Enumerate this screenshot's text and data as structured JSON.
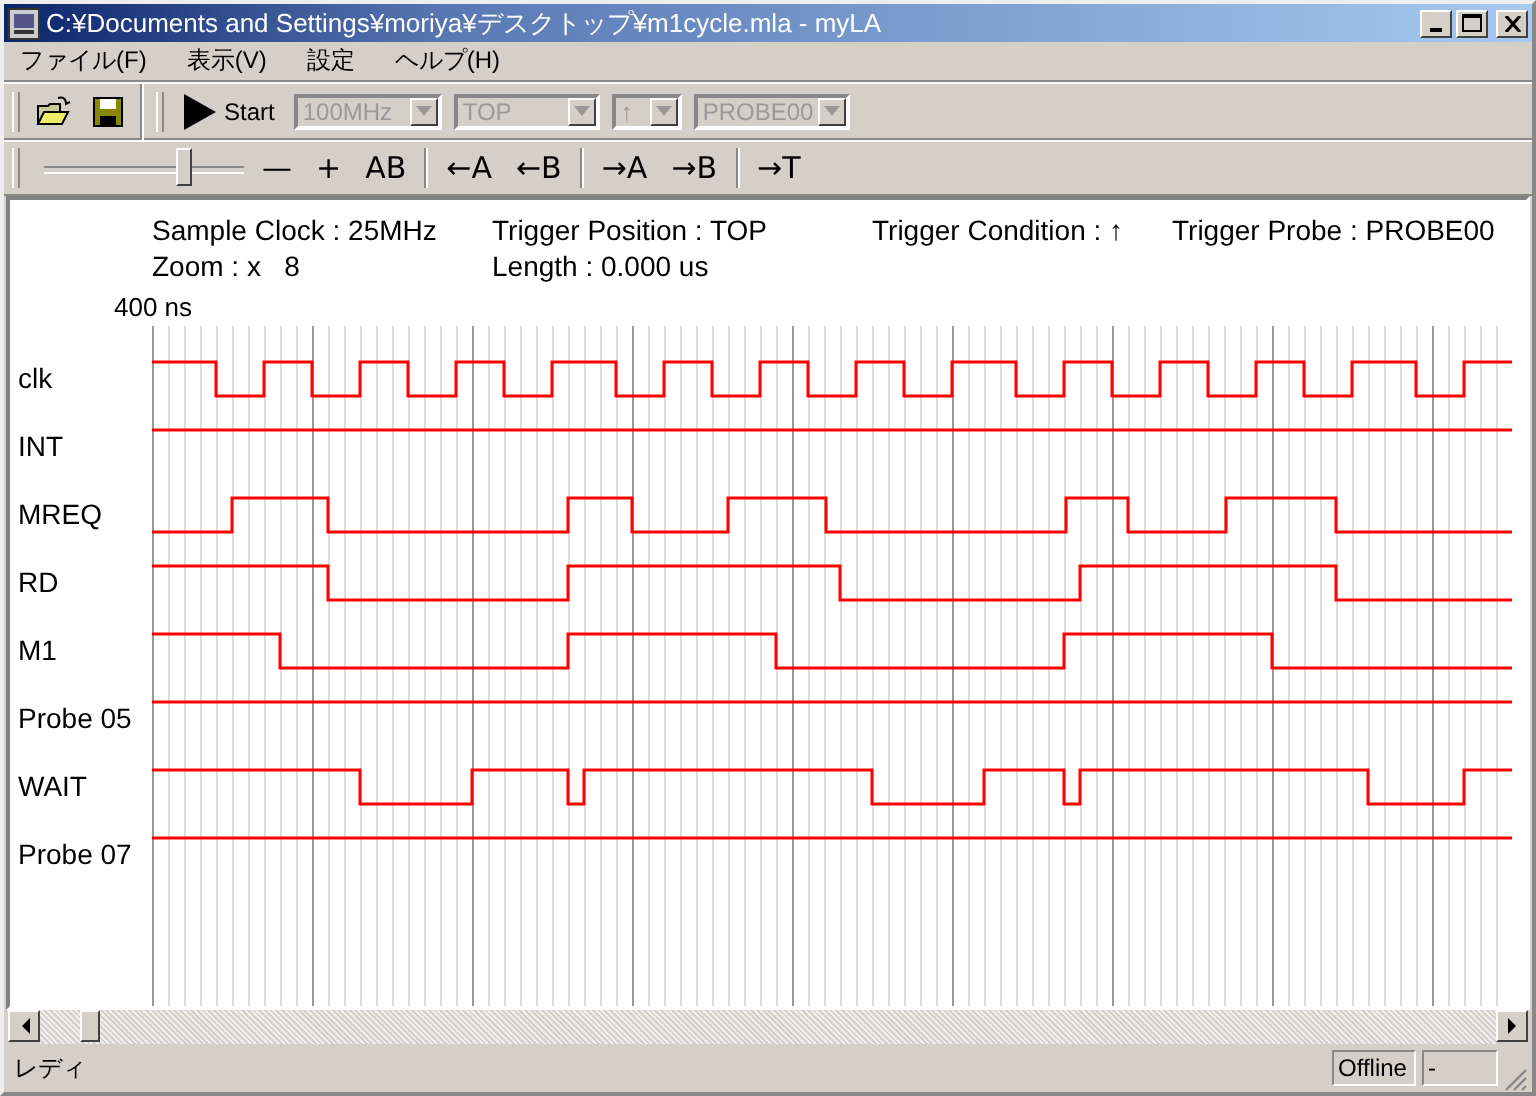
{
  "window": {
    "title": "C:¥Documents and Settings¥moriya¥デスクトップ¥m1cycle.mla - myLA"
  },
  "menu": [
    "ファイル(F)",
    "表示(V)",
    "設定",
    "ヘルプ(H)"
  ],
  "toolbar": {
    "start": "Start",
    "dropdowns": [
      {
        "value": "100MHz",
        "disabled": true
      },
      {
        "value": "TOP",
        "disabled": true
      },
      {
        "value": "↑",
        "disabled": true
      },
      {
        "value": "PROBE00",
        "disabled": true
      }
    ]
  },
  "zoom_toolbar": {
    "slider": {
      "level": 0.7
    },
    "buttons": [
      "—",
      "+",
      "AB",
      "←A",
      "←B",
      "→A",
      "→B",
      "→T"
    ]
  },
  "info": {
    "row_1": [
      "Sample Clock : 25MHz",
      "Trigger Position : TOP",
      "Trigger Condition : ↑",
      "Trigger Probe : PROBE00"
    ],
    "row_2": [
      "Zoom : x   8",
      "Length : 0.000 us"
    ]
  },
  "time_scale": "400 ns",
  "signals": [
    "clk",
    "INT",
    "MREQ",
    "RD",
    "M1",
    "Probe 05",
    "WAIT",
    "Probe 07"
  ],
  "status_bar": {
    "text": "レディ",
    "panels": [
      "Offline",
      "-"
    ]
  }
}
